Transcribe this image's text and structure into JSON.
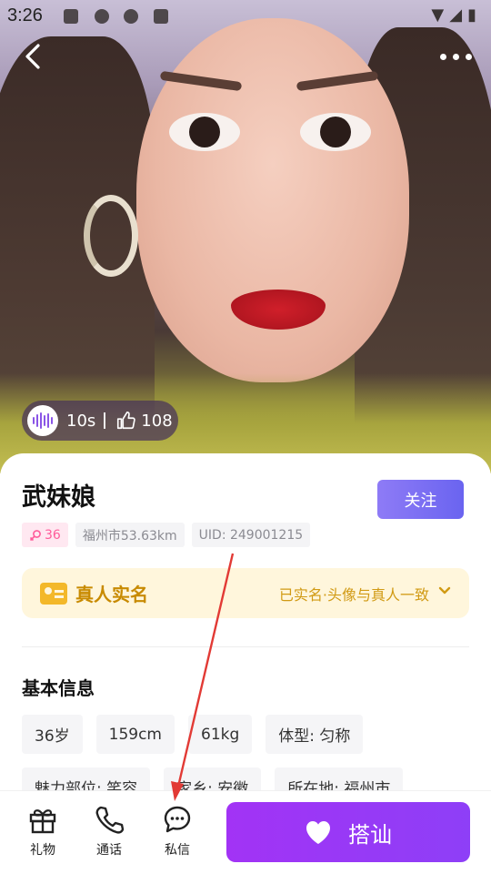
{
  "status_bar": {
    "time": "3:26"
  },
  "media": {
    "duration": "10s",
    "likes": "108"
  },
  "profile": {
    "name": "武妹娘",
    "follow_label": "关注",
    "age_tag": "36",
    "location_tag": "福州市53.63km",
    "uid_tag": "UID: 249001215"
  },
  "verification": {
    "title": "真人实名",
    "description": "已实名·头像与真人一致"
  },
  "basic_info": {
    "title": "基本信息",
    "chips": [
      "36岁",
      "159cm",
      "61kg",
      "体型: 匀称",
      "魅力部位: 笑容",
      "家乡: 安徽",
      "所在地: 福州市"
    ]
  },
  "bottom_bar": {
    "gift_label": "礼物",
    "call_label": "通话",
    "message_label": "私信",
    "chat_label": "搭讪"
  },
  "colors": {
    "accent_purple": "#8e3ff7",
    "follow_button": "#7a6ef3",
    "verify_gold": "#c88a00",
    "age_pink": "#ff5c9a",
    "annotation_red": "#e23a35"
  }
}
